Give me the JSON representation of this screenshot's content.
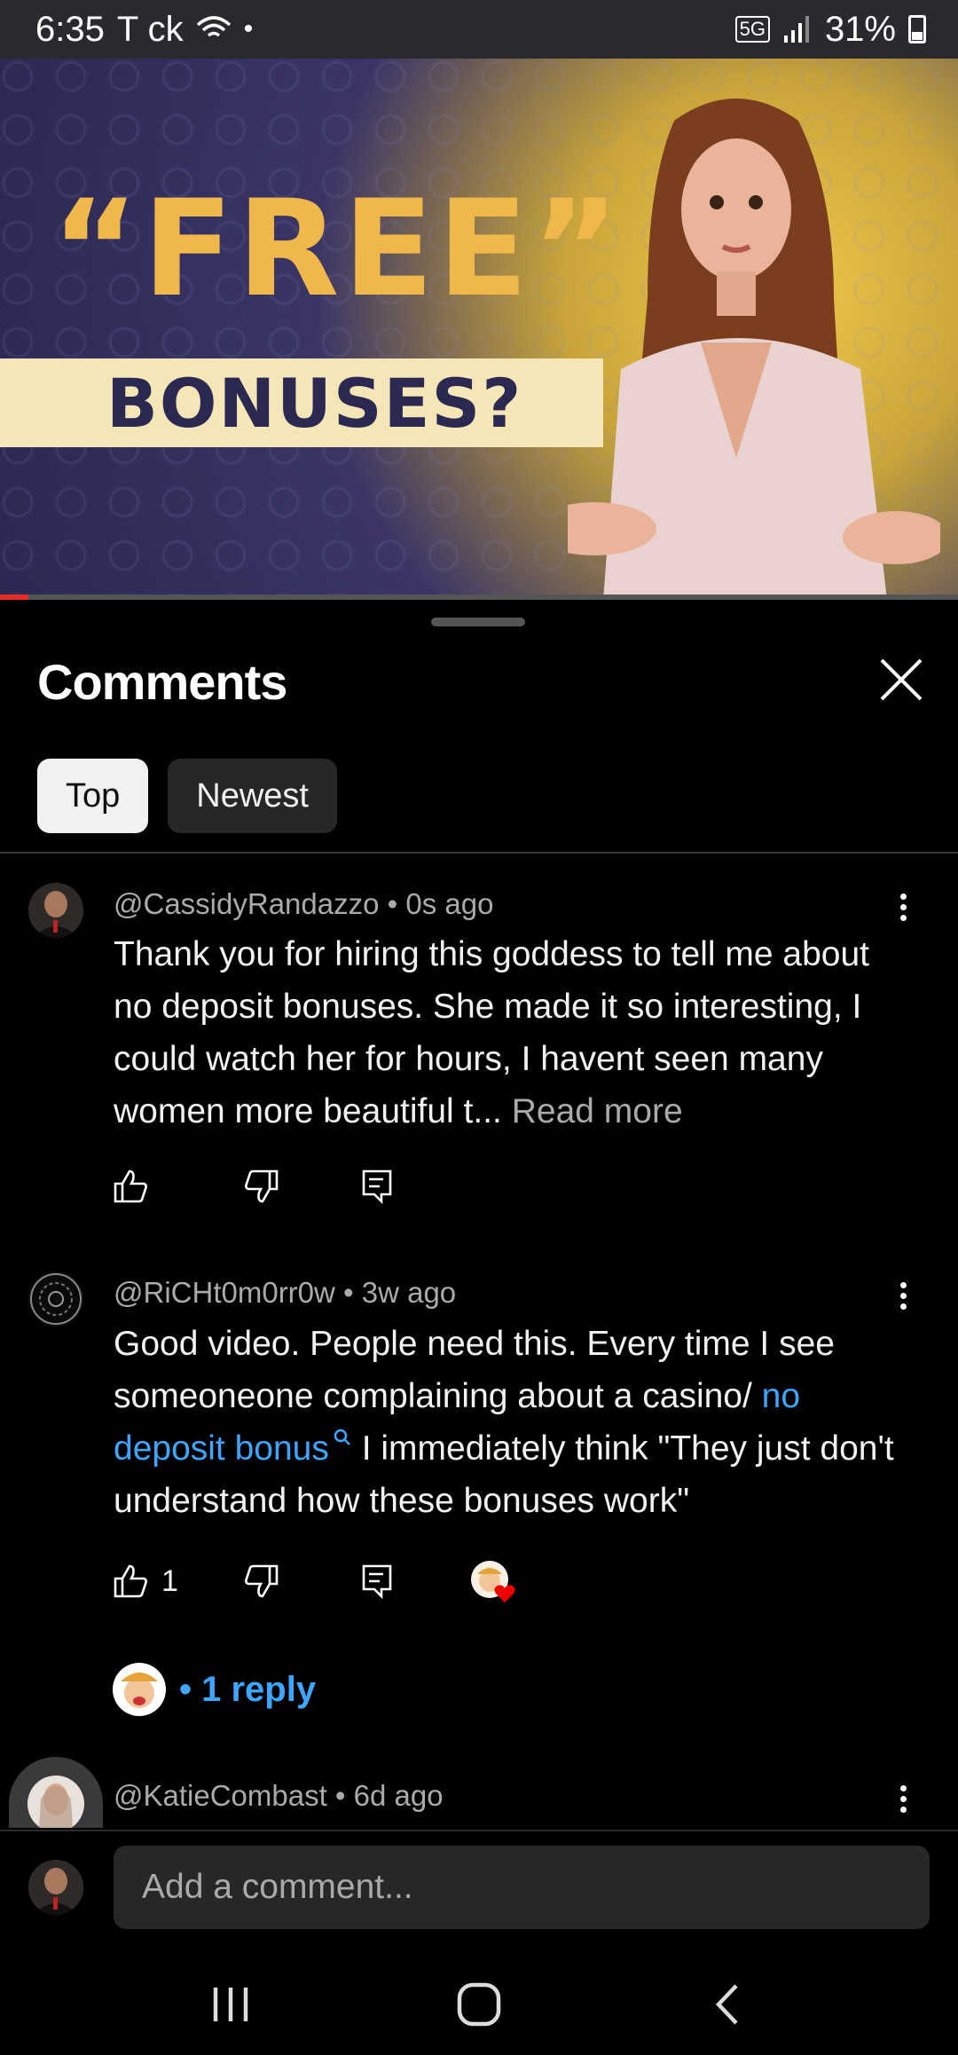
{
  "status_bar": {
    "time": "6:35",
    "carrier_icons": "T ck",
    "network": "5G",
    "battery": "31%"
  },
  "video": {
    "thumbnail_title_line1": "“FREE”",
    "thumbnail_title_line2": "BONUSES?",
    "progress": 0.03
  },
  "panel": {
    "title": "Comments",
    "chips": [
      {
        "label": "Top",
        "active": true
      },
      {
        "label": "Newest",
        "active": false
      }
    ]
  },
  "comments": [
    {
      "author": "@CassidyRandazzo",
      "time": "0s ago",
      "text": "Thank you for hiring this goddess to tell me about no deposit bonuses. She made it so interesting, I could watch her for hours, I havent seen many women more beautiful t...",
      "read_more": "Read more",
      "likes": ""
    },
    {
      "author": "@RiCHt0m0rr0w",
      "time": "3w ago",
      "text_before": "Good video. People need this. Every time I see someoneone complaining about a casino/",
      "link_text": "no deposit bonus",
      "text_after": "I immediately think \"They just don't understand how these bonuses work\"",
      "likes": "1",
      "replies_label": "• 1 reply"
    },
    {
      "author": "@KatieCombast",
      "time": "6d ago"
    }
  ],
  "add_comment": {
    "placeholder": "Add a comment..."
  },
  "colors": {
    "accent_link": "#3ea6ff",
    "progress_red": "#e52d27",
    "background": "#000000"
  },
  "icons": [
    "wifi-icon",
    "signal-icon",
    "battery-icon",
    "close-icon",
    "more-vert-icon",
    "thumb-up-icon",
    "thumb-down-icon",
    "reply-icon",
    "heart-icon",
    "recent-apps-icon",
    "home-icon",
    "back-icon"
  ]
}
